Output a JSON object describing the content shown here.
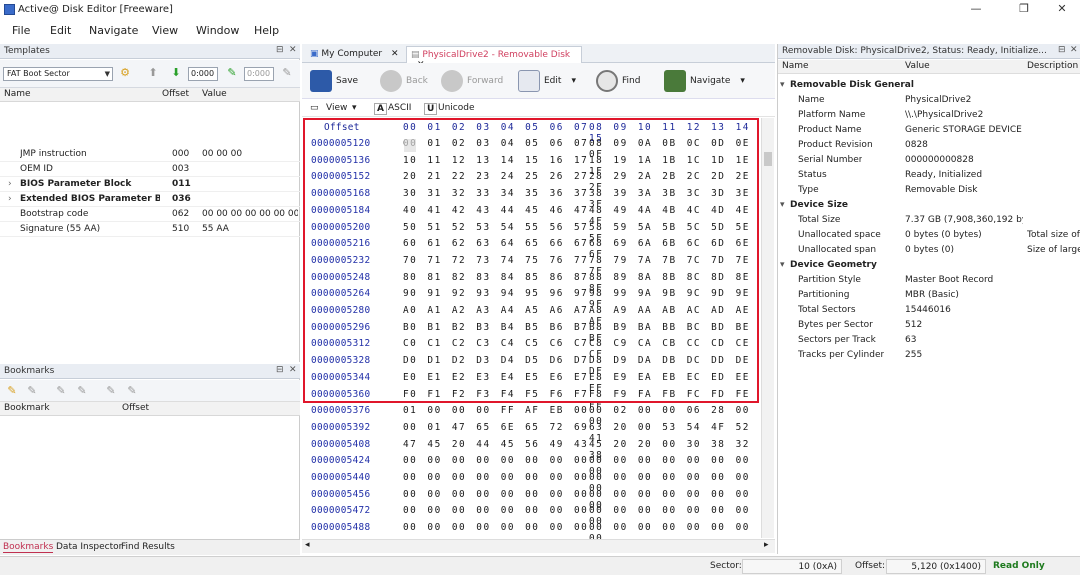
{
  "window": {
    "title": "Active@ Disk Editor [Freeware]",
    "min": "—",
    "max": "❐",
    "close": "✕"
  },
  "menu": [
    "File",
    "Edit",
    "Navigate",
    "View",
    "Window",
    "Help"
  ],
  "templates": {
    "header": "Templates",
    "combo": "FAT Boot Sector",
    "input1": "0:000",
    "input2": "0:000",
    "columns": [
      "Name",
      "Offset",
      "Value"
    ],
    "rows": [
      {
        "name": "JMP instruction",
        "offset": "000",
        "value": "00 00 00",
        "bold": false,
        "expand": false
      },
      {
        "name": "OEM ID",
        "offset": "003",
        "value": "",
        "bold": false,
        "expand": false
      },
      {
        "name": "BIOS Parameter Block",
        "offset": "011",
        "value": "",
        "bold": true,
        "expand": true
      },
      {
        "name": "Extended BIOS Parameter Bl...",
        "offset": "036",
        "value": "",
        "bold": true,
        "expand": true
      },
      {
        "name": "Bootstrap code",
        "offset": "062",
        "value": "00 00 00 00 00 00 00 ...",
        "bold": false,
        "expand": false
      },
      {
        "name": "Signature (55 AA)",
        "offset": "510",
        "value": "55 AA",
        "bold": false,
        "expand": false
      }
    ]
  },
  "bookmarks": {
    "header": "Bookmarks",
    "columns": [
      "Bookmark",
      "Offset"
    ]
  },
  "bottom_tabs": [
    "Bookmarks",
    "Data Inspector",
    "Find Results"
  ],
  "doc_tabs": [
    "My Computer",
    "PhysicalDrive2 - Removable Disk"
  ],
  "toolbar": {
    "save": "Save",
    "back": "Back",
    "forward": "Forward",
    "edit": "Edit",
    "find": "Find",
    "navigate": "Navigate"
  },
  "viewbar": {
    "view": "View",
    "ascii": "ASCII",
    "unicode": "Unicode"
  },
  "hex": {
    "header_label": "Offset",
    "header_b1": "00 01 02 03 04 05 06 07",
    "header_b2": "08 09 10 11 12 13 14 15",
    "rows": [
      {
        "off": "0000005120",
        "b1": "00 01 02 03 04 05 06 07",
        "b2": "08 09 0A 0B 0C 0D 0E 0F"
      },
      {
        "off": "0000005136",
        "b1": "10 11 12 13 14 15 16 17",
        "b2": "18 19 1A 1B 1C 1D 1E 1F"
      },
      {
        "off": "0000005152",
        "b1": "20 21 22 23 24 25 26 27",
        "b2": "28 29 2A 2B 2C 2D 2E 2F"
      },
      {
        "off": "0000005168",
        "b1": "30 31 32 33 34 35 36 37",
        "b2": "38 39 3A 3B 3C 3D 3E 3F"
      },
      {
        "off": "0000005184",
        "b1": "40 41 42 43 44 45 46 47",
        "b2": "48 49 4A 4B 4C 4D 4E 4F"
      },
      {
        "off": "0000005200",
        "b1": "50 51 52 53 54 55 56 57",
        "b2": "58 59 5A 5B 5C 5D 5E 5F"
      },
      {
        "off": "0000005216",
        "b1": "60 61 62 63 64 65 66 67",
        "b2": "68 69 6A 6B 6C 6D 6E 6F"
      },
      {
        "off": "0000005232",
        "b1": "70 71 72 73 74 75 76 77",
        "b2": "78 79 7A 7B 7C 7D 7E 7F"
      },
      {
        "off": "0000005248",
        "b1": "80 81 82 83 84 85 86 87",
        "b2": "88 89 8A 8B 8C 8D 8E 8F"
      },
      {
        "off": "0000005264",
        "b1": "90 91 92 93 94 95 96 97",
        "b2": "98 99 9A 9B 9C 9D 9E 9F"
      },
      {
        "off": "0000005280",
        "b1": "A0 A1 A2 A3 A4 A5 A6 A7",
        "b2": "A8 A9 AA AB AC AD AE AF"
      },
      {
        "off": "0000005296",
        "b1": "B0 B1 B2 B3 B4 B5 B6 B7",
        "b2": "B8 B9 BA BB BC BD BE BF"
      },
      {
        "off": "0000005312",
        "b1": "C0 C1 C2 C3 C4 C5 C6 C7",
        "b2": "C8 C9 CA CB CC CD CE CF"
      },
      {
        "off": "0000005328",
        "b1": "D0 D1 D2 D3 D4 D5 D6 D7",
        "b2": "D8 D9 DA DB DC DD DE DF"
      },
      {
        "off": "0000005344",
        "b1": "E0 E1 E2 E3 E4 E5 E6 E7",
        "b2": "E8 E9 EA EB EC ED EE EF"
      },
      {
        "off": "0000005360",
        "b1": "F0 F1 F2 F3 F4 F5 F6 F7",
        "b2": "F8 F9 FA FB FC FD FE FF"
      },
      {
        "off": "0000005376",
        "b1": "01 00 00 00 FF AF EB 00",
        "b2": "00 02 00 00 06 28 00 00"
      },
      {
        "off": "0000005392",
        "b1": "00 01 47 65 6E 65 72 69",
        "b2": "63 20 00 53 54 4F 52 41"
      },
      {
        "off": "0000005408",
        "b1": "47 45 20 44 45 56 49 43",
        "b2": "45 20 20 00 30 38 32 38"
      },
      {
        "off": "0000005424",
        "b1": "00 00 00 00 00 00 00 00",
        "b2": "00 00 00 00 00 00 00 00"
      },
      {
        "off": "0000005440",
        "b1": "00 00 00 00 00 00 00 00",
        "b2": "00 00 00 00 00 00 00 00"
      },
      {
        "off": "0000005456",
        "b1": "00 00 00 00 00 00 00 00",
        "b2": "00 00 00 00 00 00 00 00"
      },
      {
        "off": "0000005472",
        "b1": "00 00 00 00 00 00 00 00",
        "b2": "00 00 00 00 00 00 00 00"
      },
      {
        "off": "0000005488",
        "b1": "00 00 00 00 00 00 00 00",
        "b2": "00 00 00 00 00 00 00 00"
      }
    ]
  },
  "props": {
    "header": "Removable Disk: PhysicalDrive2, Status: Ready, Initialize...",
    "columns": [
      "Name",
      "Value",
      "Description"
    ],
    "items": [
      {
        "section": "Removable Disk General"
      },
      {
        "name": "Name",
        "value": "PhysicalDrive2",
        "desc": ""
      },
      {
        "name": "Platform Name",
        "value": "\\\\.\\PhysicalDrive2",
        "desc": ""
      },
      {
        "name": "Product Name",
        "value": "Generic STORAGE DEVICE ...",
        "desc": ""
      },
      {
        "name": "Product Revision",
        "value": "0828",
        "desc": ""
      },
      {
        "name": "Serial Number",
        "value": "000000000828",
        "desc": ""
      },
      {
        "name": "Status",
        "value": "Ready, Initialized",
        "desc": ""
      },
      {
        "name": "Type",
        "value": "Removable Disk",
        "desc": ""
      },
      {
        "section": "Device Size"
      },
      {
        "name": "Total Size",
        "value": "7.37 GB (7,908,360,192 byt...",
        "desc": ""
      },
      {
        "name": "Unallocated space",
        "value": "0 bytes (0 bytes)",
        "desc": "Total size of"
      },
      {
        "name": "Unallocated span",
        "value": "0 bytes (0)",
        "desc": "Size of larges"
      },
      {
        "section": "Device Geometry"
      },
      {
        "name": "Partition Style",
        "value": "Master Boot Record",
        "desc": ""
      },
      {
        "name": "Partitioning",
        "value": "MBR (Basic)",
        "desc": ""
      },
      {
        "name": "Total Sectors",
        "value": "15446016",
        "desc": ""
      },
      {
        "name": "Bytes per Sector",
        "value": "512",
        "desc": ""
      },
      {
        "name": "Sectors per Track",
        "value": "63",
        "desc": ""
      },
      {
        "name": "Tracks per Cylinder",
        "value": "255",
        "desc": ""
      }
    ]
  },
  "status": {
    "sector_label": "Sector:",
    "sector": "10 (0xA)",
    "offset_label": "Offset:",
    "offset": "5,120 (0x1400)",
    "mode": "Read Only"
  },
  "colors": {
    "highlight": "#e0162b",
    "offset_text": "#2230a8",
    "active_tab": "#d04060",
    "read_only": "#1e7a1e"
  }
}
